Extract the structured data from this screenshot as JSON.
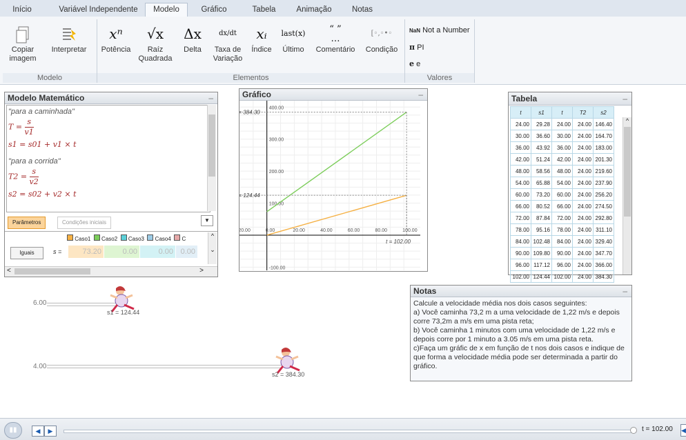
{
  "tabs": [
    "Início",
    "Variável Independente",
    "Modelo",
    "Gráfico",
    "Tabela",
    "Animação",
    "Notas"
  ],
  "ribbon": {
    "modelo_group": {
      "title": "Modelo",
      "buttons": [
        {
          "label": "Copiar\nimagem",
          "icon": "copy-icon"
        },
        {
          "label": "Interpretar",
          "icon": "interpret-icon"
        }
      ]
    },
    "elementos_group": {
      "title": "Elementos",
      "buttons": [
        {
          "symbol": "xⁿ",
          "label": "Potência"
        },
        {
          "symbol": "√x",
          "label": "Raíz\nQuadrada"
        },
        {
          "symbol": "Δx",
          "label": "Delta"
        },
        {
          "symbol": "dx/dt",
          "label": "Taxa de\nVariação"
        },
        {
          "symbol": "xᵢ",
          "label": "Índice"
        },
        {
          "symbol": "last(x)",
          "label": "Último"
        },
        {
          "symbol": "“ ”\n…",
          "label": "Comentário"
        },
        {
          "symbol": "[◦,◦•◦",
          "label": "Condição"
        }
      ]
    },
    "valores_group": {
      "title": "Valores",
      "items": [
        {
          "symbol": "NaN",
          "label": "Not a Number"
        },
        {
          "symbol": "π",
          "label": "PI"
        },
        {
          "symbol": "e",
          "label": "e"
        }
      ]
    }
  },
  "model_panel": {
    "title": "Modelo Matemático",
    "lines": [
      "\"para a caminhada\"",
      "T = s / v1",
      "s1 = s01 + v1 × t",
      "\"para a corrida\"",
      "T2 = s / v2",
      "s2 = s02 + v2 × t"
    ],
    "tab_active": "Parâmetros",
    "tab_inactive": "Condições iniciais",
    "cases": [
      "Caso1",
      "Caso2",
      "Caso3",
      "Caso4",
      "C"
    ],
    "equal_button": "Iguais",
    "var_label": "s =",
    "case_values": [
      "73.20",
      "0.00",
      "0.00",
      "0.00"
    ]
  },
  "graph_panel": {
    "title": "Gráfico",
    "label_s2": "s2 = 384.30",
    "label_s1": "s1 = 124.44",
    "label_t": "t = 102.00",
    "y_ticks": [
      "400.00",
      "300.00",
      "200.00",
      "100.00",
      "-100.00"
    ],
    "x_ticks": [
      "-20.00",
      "0.00",
      "20.00",
      "40.00",
      "60.00",
      "80.00",
      "100.00"
    ]
  },
  "chart_data": {
    "type": "line",
    "xlim": [
      -20,
      100
    ],
    "ylim": [
      -100,
      400
    ],
    "series": [
      {
        "name": "s2",
        "color": "#7ccd5a",
        "x": [
          0,
          102
        ],
        "values": [
          73.2,
          384.3
        ]
      },
      {
        "name": "s1",
        "color": "#f5b043",
        "x": [
          0,
          102
        ],
        "values": [
          0,
          124.44
        ]
      }
    ]
  },
  "table_panel": {
    "title": "Tabela",
    "headers": [
      "t",
      "s1",
      "t",
      "T2",
      "s2"
    ],
    "rows": [
      [
        "24.00",
        "29.28",
        "24.00",
        "24.00",
        "146.40"
      ],
      [
        "30.00",
        "36.60",
        "30.00",
        "24.00",
        "164.70"
      ],
      [
        "36.00",
        "43.92",
        "36.00",
        "24.00",
        "183.00"
      ],
      [
        "42.00",
        "51.24",
        "42.00",
        "24.00",
        "201.30"
      ],
      [
        "48.00",
        "58.56",
        "48.00",
        "24.00",
        "219.60"
      ],
      [
        "54.00",
        "65.88",
        "54.00",
        "24.00",
        "237.90"
      ],
      [
        "60.00",
        "73.20",
        "60.00",
        "24.00",
        "256.20"
      ],
      [
        "66.00",
        "80.52",
        "66.00",
        "24.00",
        "274.50"
      ],
      [
        "72.00",
        "87.84",
        "72.00",
        "24.00",
        "292.80"
      ],
      [
        "78.00",
        "95.16",
        "78.00",
        "24.00",
        "311.10"
      ],
      [
        "84.00",
        "102.48",
        "84.00",
        "24.00",
        "329.40"
      ],
      [
        "90.00",
        "109.80",
        "90.00",
        "24.00",
        "347.70"
      ],
      [
        "96.00",
        "117.12",
        "96.00",
        "24.00",
        "366.00"
      ],
      [
        "102.00",
        "124.44",
        "102.00",
        "24.00",
        "384.30"
      ]
    ]
  },
  "animation": {
    "track1_value": "6.00",
    "track1_label": "s1 = 124.44",
    "track2_value": "4.00",
    "track2_label": "s2 = 384.30"
  },
  "notes_panel": {
    "title": "Notas",
    "text": "Calcule a velocidade média nos dois casos seguintes:\na) Você caminha 73,2 m a uma velocidade de 1,22 m/s e depois corre 73,2m a m/s em uma pista reta;\nb) Você caminha 1 minutos com uma velocidade de 1,22 m/s e depois corre por 1 minuto a 3.05 m/s em uma pista reta.\nc)Faça um gráfic de x em função de t nos dois casos e indique de que forma a velocidade média pode ser determinada a partir do gráfico."
  },
  "bottom_bar": {
    "time_label": "t = 102.00",
    "progress": 1.0
  }
}
